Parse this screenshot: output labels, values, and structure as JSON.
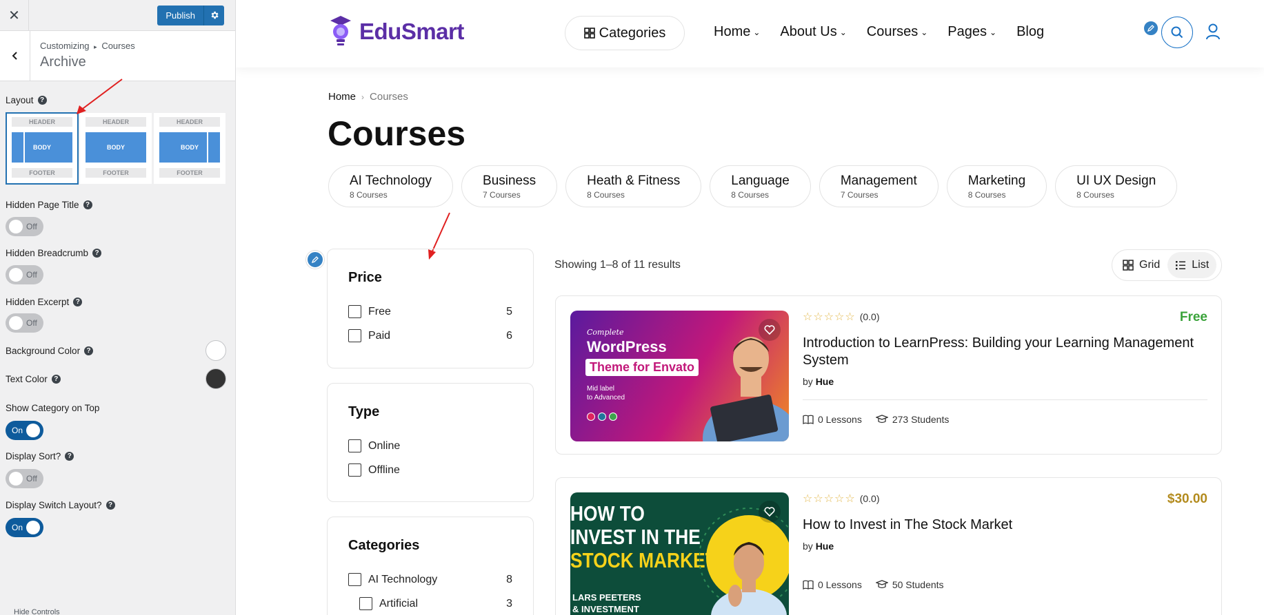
{
  "customizer": {
    "publish_label": "Publish",
    "breadcrumb_root": "Customizing",
    "breadcrumb_sep": "▸",
    "breadcrumb_section": "Courses",
    "section_title": "Archive",
    "layout_label": "Layout",
    "layout_options": [
      {
        "header": "HEADER",
        "body": "BODY",
        "footer": "FOOTER"
      },
      {
        "header": "HEADER",
        "body": "BODY",
        "footer": "FOOTER"
      },
      {
        "header": "HEADER",
        "body": "BODY",
        "footer": "FOOTER"
      }
    ],
    "hidden_page_title": {
      "label": "Hidden Page Title",
      "state": "Off"
    },
    "hidden_breadcrumb": {
      "label": "Hidden Breadcrumb",
      "state": "Off"
    },
    "hidden_excerpt": {
      "label": "Hidden Excerpt",
      "state": "Off"
    },
    "background_color": {
      "label": "Background Color",
      "value": "#ffffff"
    },
    "text_color": {
      "label": "Text Color",
      "value": "#333333"
    },
    "show_category_top": {
      "label": "Show Category on Top",
      "state": "On"
    },
    "display_sort": {
      "label": "Display Sort?",
      "state": "Off"
    },
    "display_switch_layout": {
      "label": "Display Switch Layout?",
      "state": "On"
    },
    "footer_text": "Hide Controls"
  },
  "site": {
    "logo_text": "EduSmart",
    "categories_label": "Categories",
    "nav": [
      "Home",
      "About Us",
      "Courses",
      "Pages",
      "Blog"
    ],
    "breadcrumb": {
      "home": "Home",
      "current": "Courses"
    },
    "page_title": "Courses",
    "category_pills": [
      {
        "name": "AI Technology",
        "count": "8 Courses"
      },
      {
        "name": "Business",
        "count": "7 Courses"
      },
      {
        "name": "Heath & Fitness",
        "count": "8 Courses"
      },
      {
        "name": "Language",
        "count": "8 Courses"
      },
      {
        "name": "Management",
        "count": "7 Courses"
      },
      {
        "name": "Marketing",
        "count": "8 Courses"
      },
      {
        "name": "UI UX Design",
        "count": "8 Courses"
      }
    ],
    "filters": {
      "price": {
        "title": "Price",
        "items": [
          {
            "label": "Free",
            "count": "5"
          },
          {
            "label": "Paid",
            "count": "6"
          }
        ]
      },
      "type": {
        "title": "Type",
        "items": [
          {
            "label": "Online"
          },
          {
            "label": "Offline"
          }
        ]
      },
      "categories": {
        "title": "Categories",
        "items": [
          {
            "label": "AI Technology",
            "count": "8"
          },
          {
            "label": "Artificial",
            "count": "3"
          }
        ]
      }
    },
    "results_text": "Showing 1–8 of 11 results",
    "layout_switch": {
      "grid": "Grid",
      "list": "List"
    },
    "courses": [
      {
        "rating": "(0.0)",
        "price": "Free",
        "price_color": "#3aa33a",
        "title": "Introduction to LearnPress: Building your Learning Management System",
        "by": "by",
        "author": "Hue",
        "lessons": "0 Lessons",
        "students": "273 Students",
        "thumb": {
          "line1": "Complete",
          "line2": "WordPress",
          "line3": "Theme for Envato",
          "line4": "Mid label",
          "line5": "to Advanced"
        }
      },
      {
        "rating": "(0.0)",
        "price": "$30.00",
        "price_color": "#b38b1e",
        "title": "How to Invest in The Stock Market",
        "by": "by",
        "author": "Hue",
        "lessons": "0 Lessons",
        "students": "50 Students",
        "thumb": {
          "line1": "HOW TO",
          "line2": "INVEST IN THE",
          "line3": "STOCK MARKET",
          "line4": "LARS PEETERS",
          "line5": "& INVESTMENT"
        }
      }
    ]
  },
  "colors": {
    "accent": "#2271b1",
    "brand": "#5b2ea6",
    "annotation_arrow": "#e02020"
  }
}
